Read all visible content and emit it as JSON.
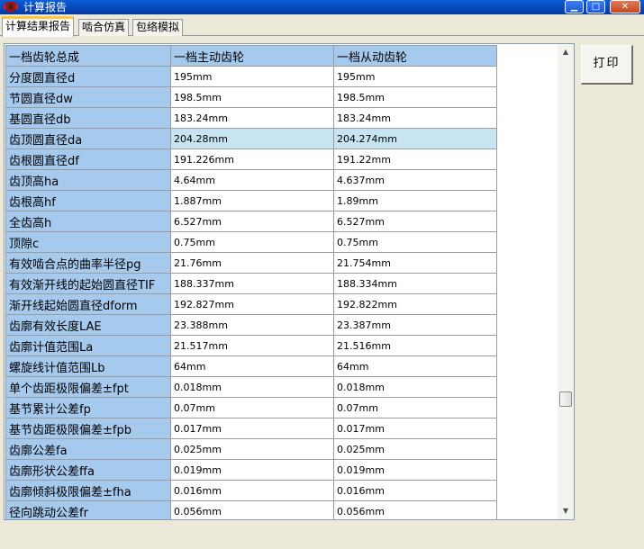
{
  "window": {
    "title": "计算报告",
    "controls": {
      "minimize": "▁",
      "maximize": "□",
      "close": "✕"
    },
    "icon": "app-red-icon"
  },
  "tabs": [
    {
      "label": "计算结果报告",
      "active": true
    },
    {
      "label": "啮合仿真",
      "active": false
    },
    {
      "label": "包络模拟",
      "active": false
    }
  ],
  "print_button": {
    "label": "打印"
  },
  "table": {
    "headers": [
      "一档齿轮总成",
      "一档主动齿轮",
      "一档从动齿轮"
    ],
    "selected_row": 3,
    "rows": [
      {
        "label": "分度圆直径d",
        "drive": "195mm",
        "driven": "195mm"
      },
      {
        "label": "节圆直径dw",
        "drive": "198.5mm",
        "driven": "198.5mm"
      },
      {
        "label": "基圆直径db",
        "drive": "183.24mm",
        "driven": "183.24mm"
      },
      {
        "label": "齿顶圆直径da",
        "drive": "204.28mm",
        "driven": "204.274mm"
      },
      {
        "label": "齿根圆直径df",
        "drive": "191.226mm",
        "driven": "191.22mm"
      },
      {
        "label": "齿顶高ha",
        "drive": "4.64mm",
        "driven": "4.637mm"
      },
      {
        "label": "齿根高hf",
        "drive": "1.887mm",
        "driven": "1.89mm"
      },
      {
        "label": "全齿高h",
        "drive": "6.527mm",
        "driven": "6.527mm"
      },
      {
        "label": "顶隙c",
        "drive": "0.75mm",
        "driven": "0.75mm"
      },
      {
        "label": "有效啮合点的曲率半径pg",
        "drive": "21.76mm",
        "driven": "21.754mm"
      },
      {
        "label": "有效渐开线的起始圆直径TIF",
        "drive": "188.337mm",
        "driven": "188.334mm"
      },
      {
        "label": "渐开线起始圆直径dform",
        "drive": "192.827mm",
        "driven": "192.822mm"
      },
      {
        "label": "齿廓有效长度LAE",
        "drive": "23.388mm",
        "driven": "23.387mm"
      },
      {
        "label": "齿廓计值范围La",
        "drive": "21.517mm",
        "driven": "21.516mm"
      },
      {
        "label": "螺旋线计值范围Lb",
        "drive": "64mm",
        "driven": "64mm"
      },
      {
        "label": "单个齿距极限偏差±fpt",
        "drive": "0.018mm",
        "driven": "0.018mm"
      },
      {
        "label": "基节累计公差fp",
        "drive": "0.07mm",
        "driven": "0.07mm"
      },
      {
        "label": "基节齿距极限偏差±fpb",
        "drive": "0.017mm",
        "driven": "0.017mm"
      },
      {
        "label": "齿廓公差fa",
        "drive": "0.025mm",
        "driven": "0.025mm"
      },
      {
        "label": "齿廓形状公差ffa",
        "drive": "0.019mm",
        "driven": "0.019mm"
      },
      {
        "label": "齿廓倾斜极限偏差±fha",
        "drive": "0.016mm",
        "driven": "0.016mm"
      },
      {
        "label": "径向跳动公差fr",
        "drive": "0.056mm",
        "driven": "0.056mm"
      }
    ]
  },
  "scrollbar": {
    "up_arrow": "▲",
    "down_arrow": "▼"
  },
  "colors": {
    "header_bg": "#a6c9ee",
    "selected_row_bg": "#c6e4f2",
    "titlebar": "#0a5fd8",
    "active_tab_accent": "#ffc83c"
  }
}
